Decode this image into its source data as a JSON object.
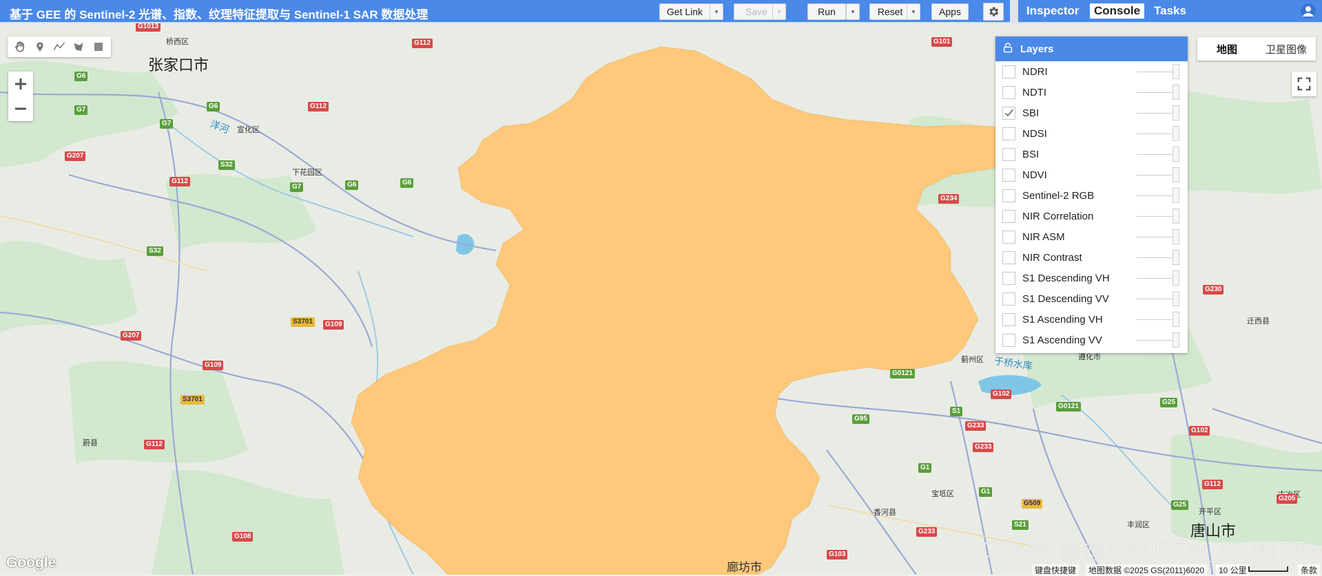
{
  "toolbar": {
    "app_title": "基于 GEE 的 Sentinel-2 光谱、指数、纹理特征提取与 Sentinel-1 SAR 数据处理",
    "get_link": "Get Link",
    "save": "Save",
    "run": "Run",
    "reset": "Reset",
    "apps": "Apps",
    "dropdown_glyph": "▾"
  },
  "right_tabs": {
    "inspector": "Inspector",
    "console": "Console",
    "tasks": "Tasks"
  },
  "map": {
    "map_type": [
      "地图",
      "卫星图像"
    ],
    "selected_map_type": "地图",
    "zoom_in": "+",
    "zoom_out": "−",
    "fill_color": "#ffc87a",
    "city_labels": [
      "张家口市",
      "唐山市",
      "廊坊市"
    ],
    "place_labels": [
      "桥西区",
      "宣化区",
      "下花园区",
      "蔚县",
      "洋河",
      "迁西县",
      "蓟州区",
      "于桥水库",
      "遵化市",
      "宝坻区",
      "香河县",
      "丰润区",
      "开平区",
      "古冶区"
    ],
    "road_shields": {
      "red": [
        "G1013",
        "G112",
        "G112",
        "G207",
        "G112",
        "G207",
        "G109",
        "G109",
        "G112",
        "G108",
        "G101",
        "G234",
        "G230",
        "G102",
        "G233",
        "G233",
        "G102",
        "G112",
        "G205",
        "G103",
        "G233"
      ],
      "green": [
        "G6",
        "G6",
        "G7",
        "G7",
        "G6",
        "G7",
        "G6",
        "S32",
        "S32",
        "S3701",
        "S3701",
        "G0121",
        "G95",
        "S1",
        "G0121",
        "G25",
        "G1",
        "G1",
        "G509",
        "S21",
        "G25"
      ]
    }
  },
  "layers": {
    "title": "Layers",
    "items": [
      {
        "name": "NDRI",
        "checked": false
      },
      {
        "name": "NDTI",
        "checked": false
      },
      {
        "name": "SBI",
        "checked": true
      },
      {
        "name": "NDSI",
        "checked": false
      },
      {
        "name": "BSI",
        "checked": false
      },
      {
        "name": "NDVI",
        "checked": false
      },
      {
        "name": "Sentinel-2 RGB",
        "checked": false
      },
      {
        "name": "NIR Correlation",
        "checked": false
      },
      {
        "name": "NIR ASM",
        "checked": false
      },
      {
        "name": "NIR Contrast",
        "checked": false
      },
      {
        "name": "S1 Descending VH",
        "checked": false
      },
      {
        "name": "S1 Descending VV",
        "checked": false
      },
      {
        "name": "S1 Ascending VH",
        "checked": false
      },
      {
        "name": "S1 Ascending VV",
        "checked": false
      }
    ]
  },
  "footer": {
    "google": "Google",
    "shortcuts": "键盘快捷键",
    "map_data": "地图数据 ©2025 GS(2011)6020",
    "scale": "10 公里",
    "terms": "条款",
    "watermark": "CSDN @@HKUSTer_CUMTBer"
  }
}
